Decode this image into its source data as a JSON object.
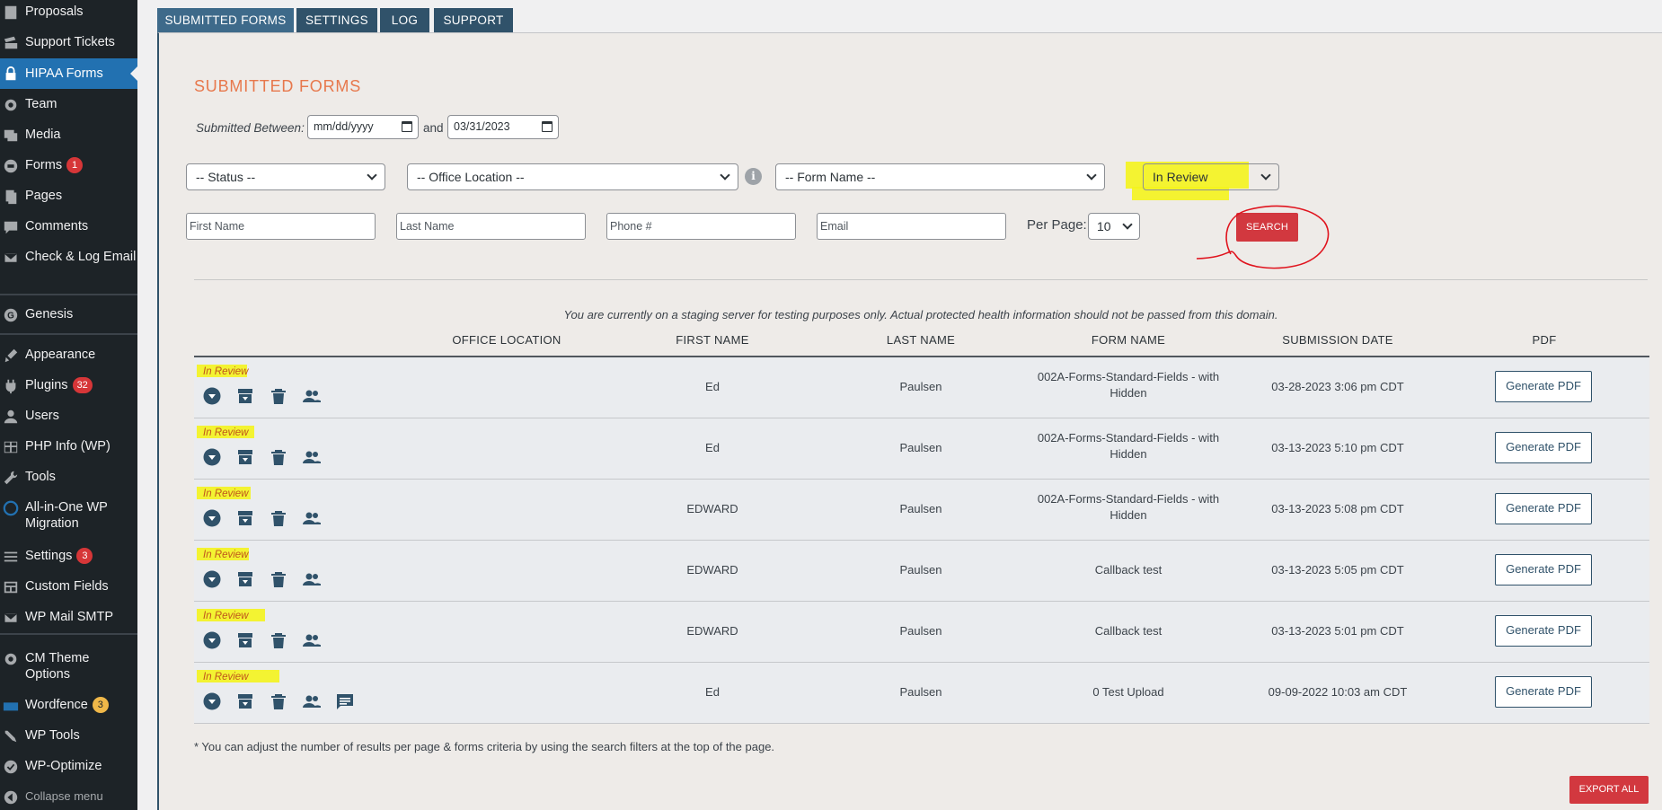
{
  "sidebar": {
    "items": [
      {
        "label": "Proposals",
        "icon": "document-icon"
      },
      {
        "label": "Support Tickets",
        "icon": "tickets-icon"
      },
      {
        "label": "HIPAA Forms",
        "icon": "lock-icon"
      },
      {
        "label": "Team",
        "icon": "gear-icon"
      },
      {
        "label": "Media",
        "icon": "media-icon"
      },
      {
        "label": "Forms",
        "icon": "forms-icon",
        "badge": "1"
      },
      {
        "label": "Pages",
        "icon": "pages-icon"
      },
      {
        "label": "Comments",
        "icon": "comment-icon"
      },
      {
        "label": "Check & Log Email",
        "icon": "email-icon"
      },
      {
        "label": "Genesis",
        "icon": "genesis-icon"
      },
      {
        "label": "Appearance",
        "icon": "brush-icon"
      },
      {
        "label": "Plugins",
        "icon": "plugin-icon",
        "badge": "32"
      },
      {
        "label": "Users",
        "icon": "user-icon"
      },
      {
        "label": "PHP Info (WP)",
        "icon": "table-icon"
      },
      {
        "label": "Tools",
        "icon": "wrench-icon"
      },
      {
        "label": "All-in-One WP Migration",
        "icon": "migration-icon"
      },
      {
        "label": "Settings",
        "icon": "settings-icon",
        "badge": "3"
      },
      {
        "label": "Custom Fields",
        "icon": "grid-icon"
      },
      {
        "label": "WP Mail SMTP",
        "icon": "mail-icon"
      },
      {
        "label": "CM Theme Options",
        "icon": "gear-icon"
      },
      {
        "label": "Wordfence",
        "icon": "wordfence-icon",
        "badge": "3"
      },
      {
        "label": "WP Tools",
        "icon": "tools-icon"
      },
      {
        "label": "WP-Optimize",
        "icon": "optimize-icon"
      },
      {
        "label": "Collapse menu",
        "icon": "collapse-icon"
      }
    ]
  },
  "tabs": [
    "SUBMITTED FORMS",
    "SETTINGS",
    "LOG",
    "SUPPORT"
  ],
  "page": {
    "title": "SUBMITTED FORMS",
    "submitted_between_label": "Submitted Between:",
    "date_from": "mm/dd/yyyy",
    "and_label": "and",
    "date_to": "03/31/2023",
    "status_select": "-- Status --",
    "office_select": "-- Office Location --",
    "form_name_select": "-- Form Name --",
    "review_select": "In Review",
    "first_name_placeholder": "First Name",
    "last_name_placeholder": "Last Name",
    "phone_placeholder": "Phone #",
    "email_placeholder": "Email",
    "per_page_label": "Per Page:",
    "per_page_value": "10",
    "search_label": "SEARCH",
    "notice": "You are currently on a staging server for testing purposes only. Actual protected health information should not be passed from this domain.",
    "footnote": "* You can adjust the number of results per page & forms criteria by using the search filters at the top of the page.",
    "export_label": "EXPORT ALL"
  },
  "table": {
    "headers": [
      "OFFICE LOCATION",
      "FIRST NAME",
      "LAST NAME",
      "FORM NAME",
      "SUBMISSION DATE",
      "PDF"
    ],
    "rows": [
      {
        "status": "In Review",
        "office": "",
        "first": "Ed",
        "last": "Paulsen",
        "form": "002A-Forms-Standard-Fields - with Hidden",
        "date": "03-28-2023 3:06 pm CDT",
        "pdf": "Generate PDF"
      },
      {
        "status": "In Review",
        "office": "",
        "first": "Ed",
        "last": "Paulsen",
        "form": "002A-Forms-Standard-Fields - with Hidden",
        "date": "03-13-2023 5:10 pm CDT",
        "pdf": "Generate PDF"
      },
      {
        "status": "In Review",
        "office": "",
        "first": "EDWARD",
        "last": "Paulsen",
        "form": "002A-Forms-Standard-Fields - with Hidden",
        "date": "03-13-2023 5:08 pm CDT",
        "pdf": "Generate PDF"
      },
      {
        "status": "In Review",
        "office": "",
        "first": "EDWARD",
        "last": "Paulsen",
        "form": "Callback test",
        "date": "03-13-2023 5:05 pm CDT",
        "pdf": "Generate PDF"
      },
      {
        "status": "In Review",
        "office": "",
        "first": "EDWARD",
        "last": "Paulsen",
        "form": "Callback test",
        "date": "03-13-2023 5:01 pm CDT",
        "pdf": "Generate PDF"
      },
      {
        "status": "In Review",
        "office": "",
        "first": "Ed",
        "last": "Paulsen",
        "form": "0 Test Upload",
        "date": "09-09-2022 10:03 am CDT",
        "pdf": "Generate PDF"
      }
    ]
  }
}
